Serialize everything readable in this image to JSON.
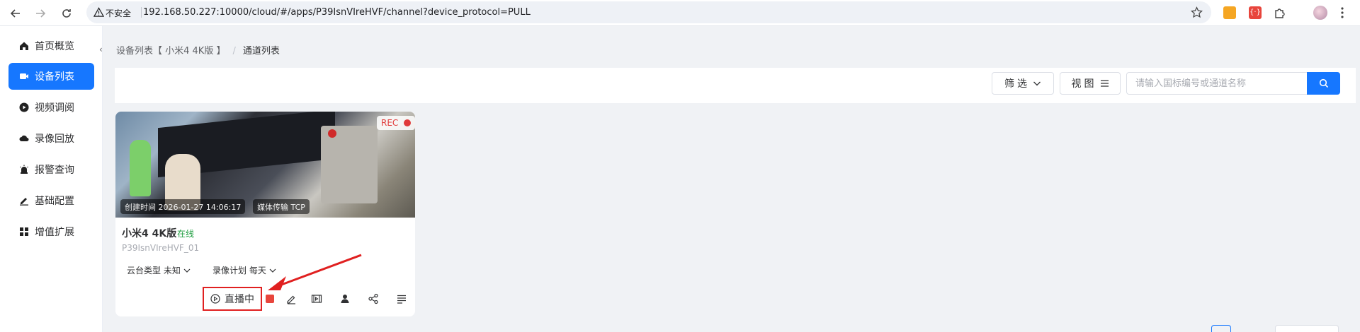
{
  "browser": {
    "insecure_label": "不安全",
    "url": "192.168.50.227:10000/cloud/#/apps/P39IsnVIreHVF/channel?device_protocol=PULL"
  },
  "sidebar": {
    "items": [
      {
        "label": "首页概览",
        "icon": "home-icon"
      },
      {
        "label": "设备列表",
        "icon": "device-icon"
      },
      {
        "label": "视频调阅",
        "icon": "play-circle-icon"
      },
      {
        "label": "录像回放",
        "icon": "cloud-icon"
      },
      {
        "label": "报警查询",
        "icon": "alarm-icon"
      },
      {
        "label": "基础配置",
        "icon": "edit-icon"
      },
      {
        "label": "增值扩展",
        "icon": "grid-icon"
      }
    ],
    "active_index": 1
  },
  "breadcrumb": {
    "parent": "设备列表【 小米4 4K版 】",
    "current": "通道列表"
  },
  "toolbar": {
    "filter_label": "筛选",
    "view_label": "视图",
    "search_placeholder": "请输入国标编号或通道名称"
  },
  "card": {
    "rec_label": "REC",
    "created_label": "创建时间 2026-01-27 14:06:17",
    "transport_label": "媒体传输 TCP",
    "name": "小米4 4K版",
    "status": "在线",
    "channel_id": "P39IsnVIreHVF_01",
    "ptz_label": "云台类型 未知",
    "record_plan_label": "录像计划 每天",
    "live_label": "直播中"
  },
  "colors": {
    "primary": "#1677ff",
    "online": "#1c9d3e",
    "annotation": "#e02020",
    "rec": "#e03a3a"
  }
}
